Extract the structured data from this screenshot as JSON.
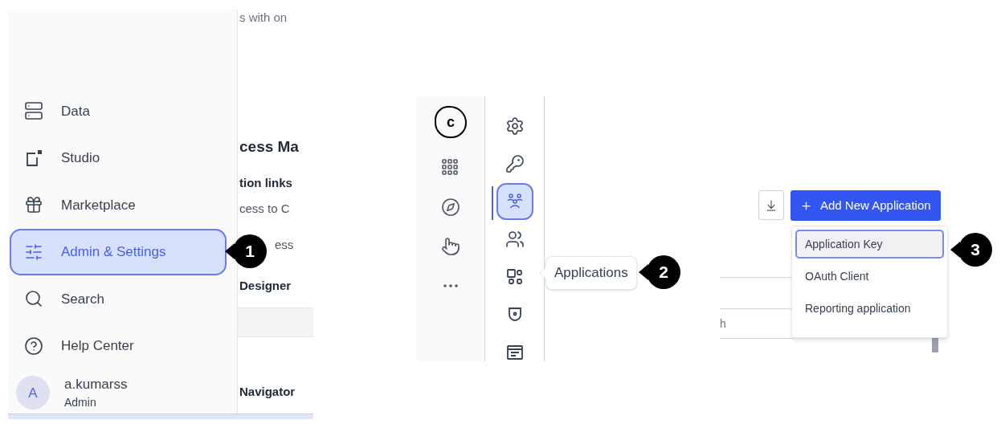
{
  "panel_1": {
    "background_text": [
      {
        "kind": "muted",
        "text": "s with on"
      },
      {
        "kind": "heading",
        "text": "cess Ma"
      },
      {
        "kind": "bold",
        "text": "tion links"
      },
      {
        "kind": "plain",
        "text": "cess to C"
      },
      {
        "kind": "plain",
        "text": "ess"
      },
      {
        "kind": "bold",
        "text": "Designer"
      },
      {
        "kind": "bold",
        "text": "Navigator"
      }
    ],
    "sidebar": {
      "items": [
        {
          "label": "Data",
          "selected": false
        },
        {
          "label": "Studio",
          "selected": false
        },
        {
          "label": "Marketplace",
          "selected": false
        },
        {
          "label": "Admin & Settings",
          "selected": true
        },
        {
          "label": "Search",
          "selected": false
        },
        {
          "label": "Help Center",
          "selected": false
        }
      ],
      "user": {
        "initial": "A",
        "name": "a.kumarss",
        "role": "Admin"
      }
    },
    "callout": "1"
  },
  "panel_2": {
    "logo_text": "c",
    "settings_items": [
      {
        "selected": false
      },
      {
        "selected": false
      },
      {
        "selected": true
      },
      {
        "selected": false
      },
      {
        "selected": false
      },
      {
        "selected": false
      },
      {
        "selected": false
      }
    ],
    "tooltip": "Applications",
    "callout": "2"
  },
  "panel_3": {
    "add_button": "Add New Application",
    "menu": [
      {
        "label": "Application Key",
        "selected": true
      },
      {
        "label": "OAuth Client",
        "selected": false
      },
      {
        "label": "Reporting application",
        "selected": false
      }
    ],
    "search": {
      "placeholder": "h"
    },
    "callout": "3"
  }
}
